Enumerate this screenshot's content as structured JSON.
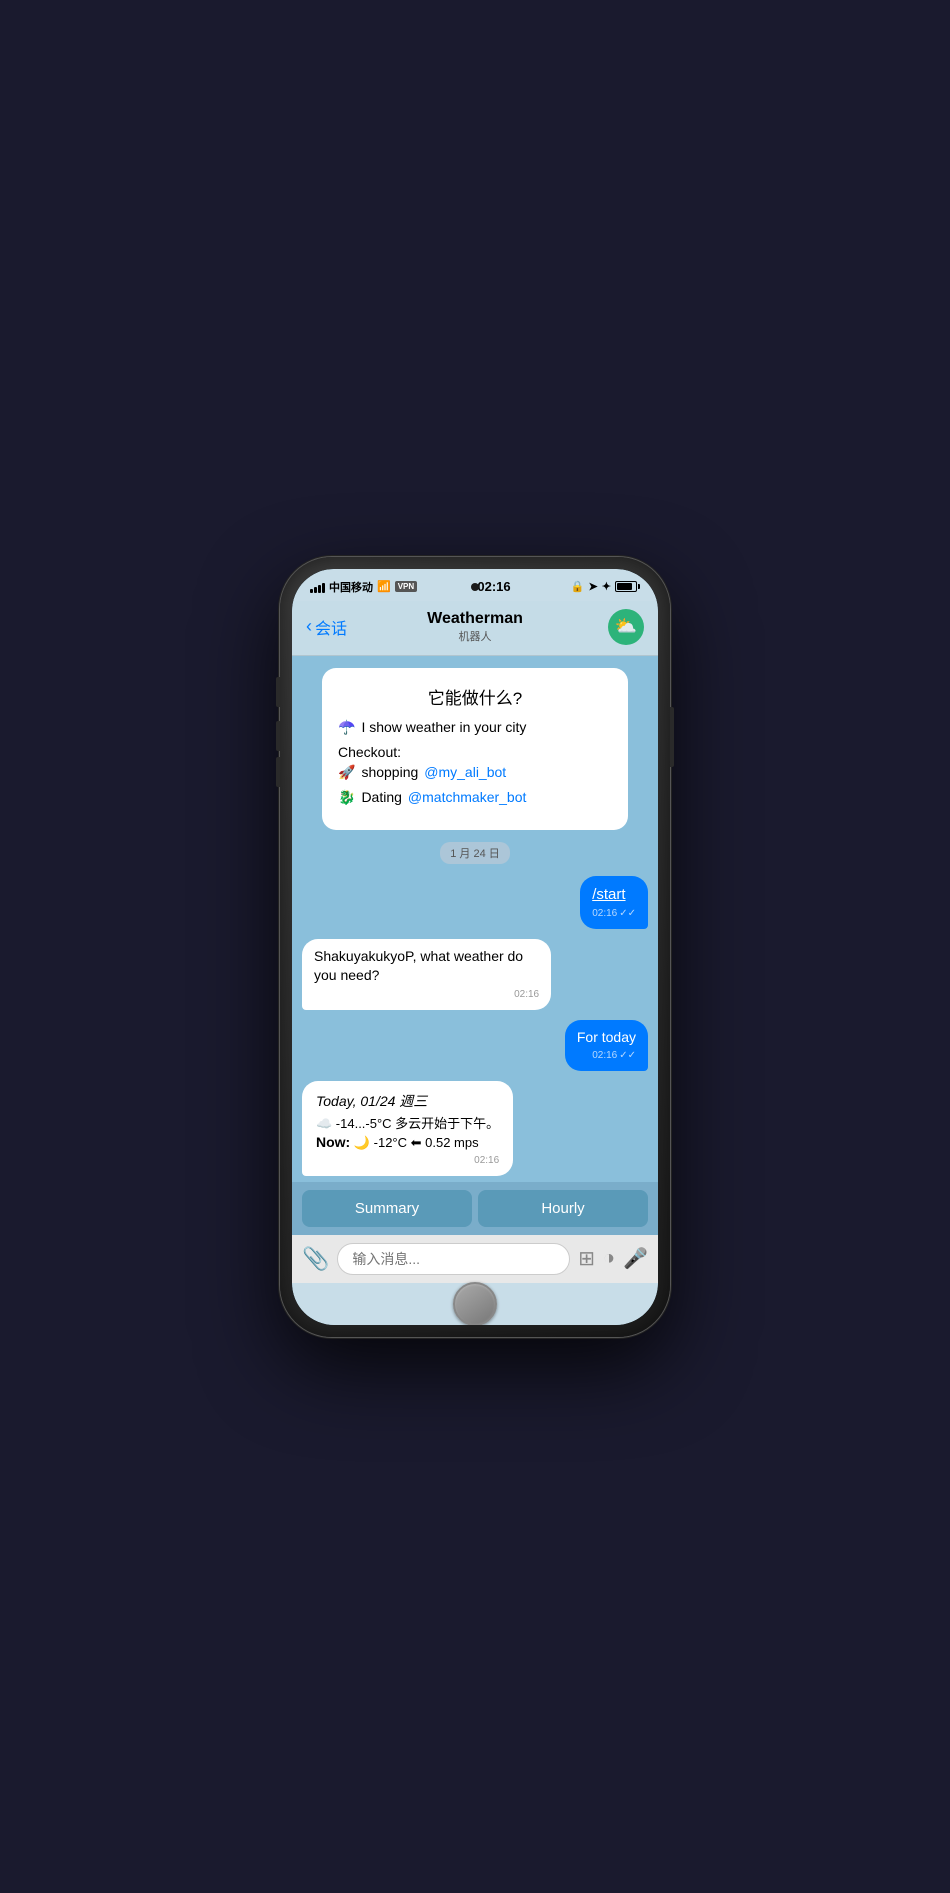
{
  "status_bar": {
    "carrier": "中国移动",
    "wifi": "WiFi",
    "vpn": "VPN",
    "time": "02:16",
    "lock_icon": "🔒",
    "location_icon": "➤",
    "bluetooth_icon": "✦"
  },
  "nav": {
    "back_label": "会话",
    "title": "Weatherman",
    "subtitle": "机器人",
    "avatar_emoji": "⛅"
  },
  "bot_intro": {
    "title": "它能做什么?",
    "line1_emoji": "☂️",
    "line1_text": "I show weather in your city",
    "checkout_label": "Checkout:",
    "link1_emoji": "🚀",
    "link1_text": "shopping ",
    "link1_handle": "@my_ali_bot",
    "link2_emoji": "🐉",
    "link2_text": "Dating ",
    "link2_handle": "@matchmaker_bot"
  },
  "date_separator": "1 月 24 日",
  "messages": [
    {
      "id": "msg1",
      "side": "right",
      "type": "blue",
      "text": "/start",
      "underline": true,
      "time": "02:16",
      "ticks": "✓✓"
    },
    {
      "id": "msg2",
      "side": "left",
      "type": "white",
      "text": "ShakuyakukyoP, what weather do you need?",
      "time": "02:16"
    },
    {
      "id": "msg3",
      "side": "right",
      "type": "blue",
      "text": "For today",
      "time": "02:16",
      "ticks": "✓✓"
    },
    {
      "id": "msg4",
      "side": "left",
      "type": "weather",
      "date_line": "Today, 01/24 週三",
      "temp_line": "☁️ -14...-5°C 多云开始于下午。",
      "now_line": "Now: 🌙 -12°C ⬅ 0.52 mps",
      "time": "02:16"
    }
  ],
  "quick_replies": [
    {
      "label": "Summary"
    },
    {
      "label": "Hourly"
    }
  ],
  "input": {
    "placeholder": "输入消息..."
  }
}
